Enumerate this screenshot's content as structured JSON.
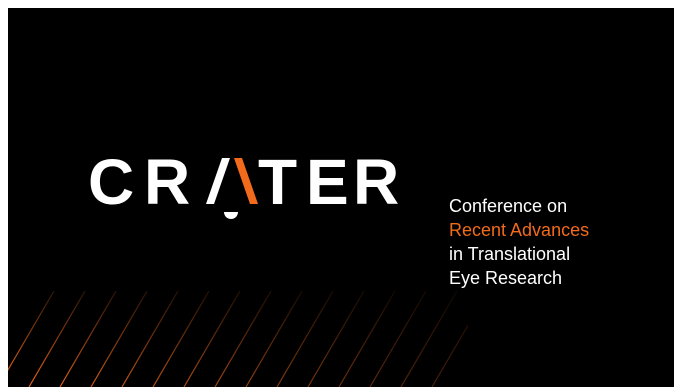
{
  "logo": {
    "text": "CRATER",
    "letters": [
      "C",
      "R",
      "A",
      "T",
      "E",
      "R"
    ],
    "accent_color": "#f26a1b",
    "icon": "crater-wordmark-logo"
  },
  "tagline": {
    "line1": "Conference on",
    "line2": "Recent Advances",
    "line3": "in Translational",
    "line4": "Eye Research"
  },
  "colors": {
    "background": "#000000",
    "text": "#ffffff",
    "accent": "#f26a1b"
  },
  "decoration": {
    "icon": "diagonal-stripes-pattern"
  }
}
